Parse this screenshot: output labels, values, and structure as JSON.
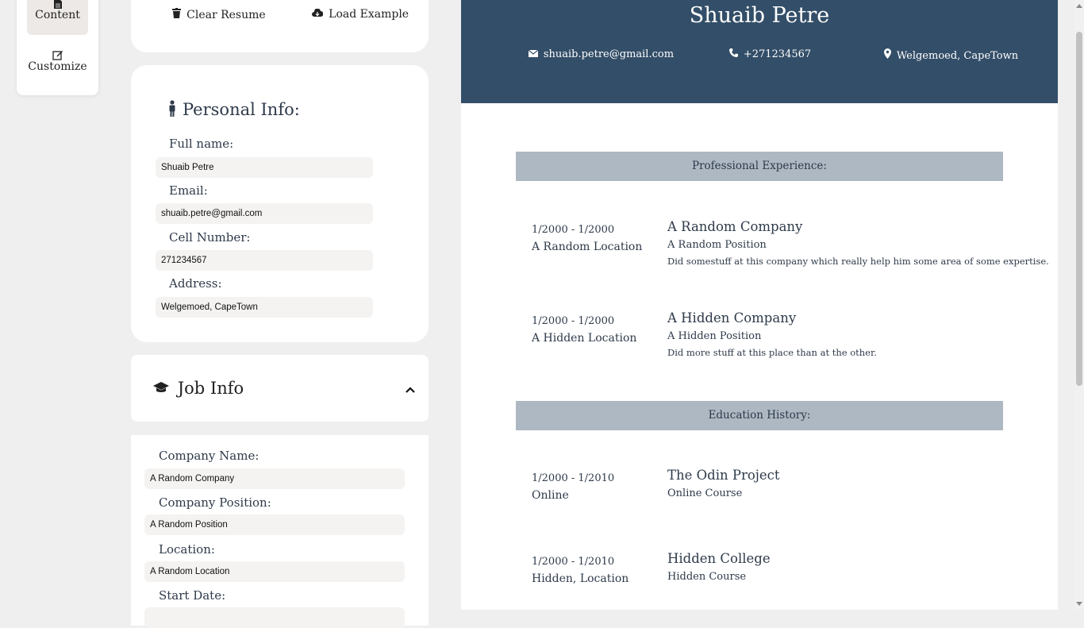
{
  "nav": {
    "content_label": "Content",
    "customize_label": "Customize"
  },
  "toolbar": {
    "clear_label": "Clear Resume",
    "load_label": "Load Example"
  },
  "personal": {
    "title": "Personal Info:",
    "fullname_label": "Full name:",
    "fullname_value": "Shuaib Petre",
    "email_label": "Email:",
    "email_value": "shuaib.petre@gmail.com",
    "cell_label": "Cell Number:",
    "cell_value": "271234567",
    "address_label": "Address:",
    "address_value": "Welgemoed, CapeTown"
  },
  "job": {
    "title": "Job Info",
    "company_label": "Company Name:",
    "company_value": "A Random Company",
    "position_label": "Company Position:",
    "position_value": "A Random Position",
    "location_label": "Location:",
    "location_value": "A Random Location",
    "start_label": "Start Date:"
  },
  "resume": {
    "name": "Shuaib Petre",
    "email": "shuaib.petre@gmail.com",
    "phone": "+271234567",
    "address": "Welgemoed, CapeTown",
    "experience_title": "Professional Experience:",
    "experience": [
      {
        "dates": "1/2000 - 1/2000",
        "location": "A Random Location",
        "company": "A Random Company",
        "position": "A Random Position",
        "description": "Did somestuff at this company which really help him some area of some expertise."
      },
      {
        "dates": "1/2000 - 1/2000",
        "location": "A Hidden Location",
        "company": "A Hidden Company",
        "position": "A Hidden Position",
        "description": "Did more stuff at this place than at the other."
      }
    ],
    "education_title": "Education History:",
    "education": [
      {
        "dates": "1/2000 - 1/2010",
        "location": "Online",
        "school": "The Odin Project",
        "course": "Online Course"
      },
      {
        "dates": "1/2000 - 1/2010",
        "location": "Hidden, Location",
        "school": "Hidden College",
        "course": "Hidden Course"
      }
    ]
  },
  "icons": {
    "content": "file-icon",
    "customize": "edit-icon",
    "clear": "trash-icon",
    "load": "cloud-download-icon",
    "personal": "person-icon",
    "job": "graduation-cap-icon",
    "collapse": "chevron-up-icon",
    "email": "envelope-icon",
    "phone": "phone-icon",
    "address": "map-marker-icon"
  },
  "colors": {
    "header_bg": "#334e68",
    "band_bg": "#adb8c3",
    "input_bg": "#f4f3f2",
    "page_bg": "#efefef"
  }
}
